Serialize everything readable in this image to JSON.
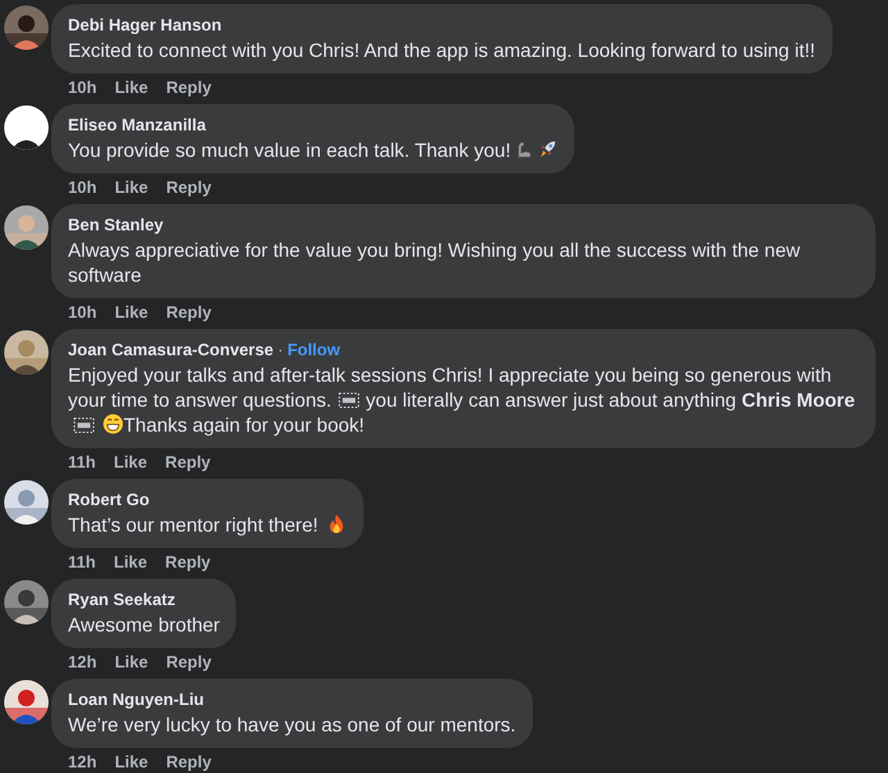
{
  "comments": [
    {
      "author": "Debi Hager Hanson",
      "avatar": {
        "kind": "picture"
      },
      "body": [
        {
          "kind": "text",
          "text": "Excited to connect with you Chris! And the app is amazing. Looking forward to using it!!"
        }
      ],
      "time": "10h",
      "like": "Like",
      "reply": "Reply"
    },
    {
      "author": "Eliseo Manzanilla",
      "avatar": {
        "kind": "picture"
      },
      "body": [
        {
          "kind": "text",
          "text": "You provide so much value in each talk. Thank you!"
        },
        {
          "kind": "muscle"
        },
        {
          "kind": "rocket"
        }
      ],
      "time": "10h",
      "like": "Like",
      "reply": "Reply"
    },
    {
      "author": "Ben Stanley",
      "avatar": {
        "kind": "picture"
      },
      "body": [
        {
          "kind": "text",
          "text": "Always appreciative for the value you bring! Wishing you all the success with the new software"
        }
      ],
      "time": "10h",
      "like": "Like",
      "reply": "Reply"
    },
    {
      "author": "Joan Camasura-Converse",
      "separator": "·",
      "follow": "Follow",
      "avatar": {
        "kind": "picture"
      },
      "body": [
        {
          "kind": "text",
          "text": "Enjoyed your talks and after-talk sessions Chris! I appreciate you being so generous with your time to answer questions. "
        },
        {
          "kind": "obj"
        },
        {
          "kind": "text",
          "text": " you literally can answer just about anything "
        },
        {
          "kind": "bold",
          "text": "Chris Moore"
        },
        {
          "kind": "obj"
        },
        {
          "kind": "grin"
        },
        {
          "kind": "text",
          "text": "Thanks again for your book!"
        }
      ],
      "time": "11h",
      "like": "Like",
      "reply": "Reply"
    },
    {
      "author": "Robert Go",
      "avatar": {
        "kind": "picture"
      },
      "body": [
        {
          "kind": "text",
          "text": "That’s our mentor right there! "
        },
        {
          "kind": "fire"
        }
      ],
      "time": "11h",
      "like": "Like",
      "reply": "Reply"
    },
    {
      "author": "Ryan Seekatz",
      "avatar": {
        "kind": "picture"
      },
      "body": [
        {
          "kind": "text",
          "text": "Awesome brother"
        }
      ],
      "time": "12h",
      "like": "Like",
      "reply": "Reply"
    },
    {
      "author": "Loan Nguyen-Liu",
      "avatar": {
        "kind": "picture"
      },
      "body": [
        {
          "kind": "text",
          "text": "We’re very lucky to have you as one of our mentors."
        }
      ],
      "time": "12h",
      "like": "Like",
      "reply": "Reply"
    }
  ]
}
